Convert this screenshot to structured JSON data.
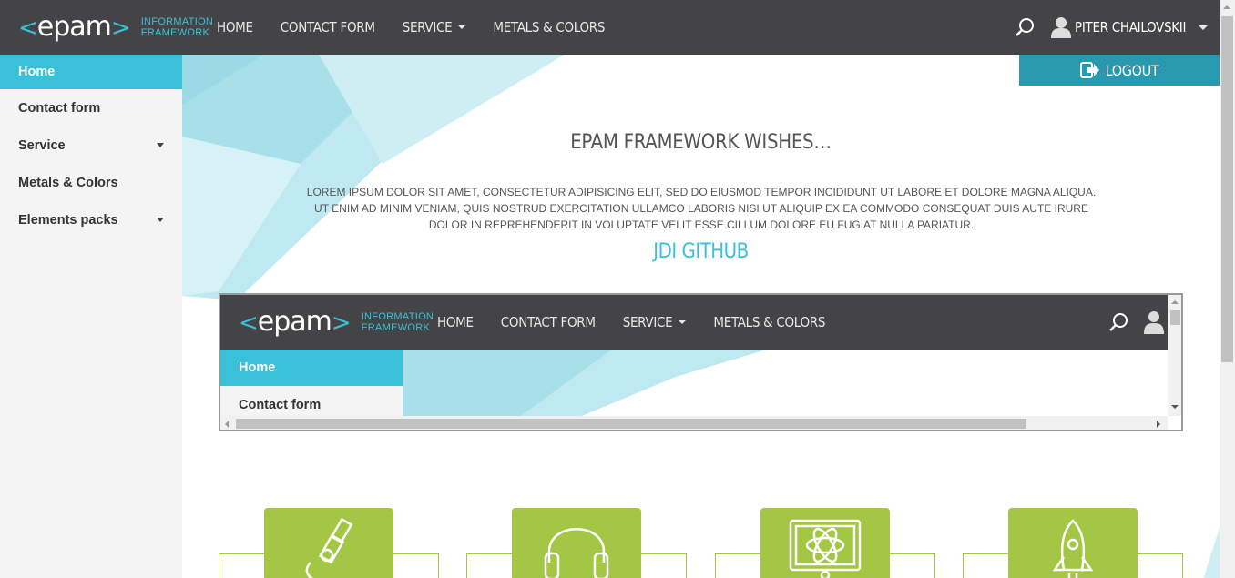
{
  "header": {
    "logo_text": "epam",
    "logo_sub_line1": "INFORMATION",
    "logo_sub_line2": "FRAMEWORK",
    "nav": [
      {
        "label": "HOME",
        "dropdown": false
      },
      {
        "label": "CONTACT FORM",
        "dropdown": false
      },
      {
        "label": "SERVICE",
        "dropdown": true
      },
      {
        "label": "METALS & COLORS",
        "dropdown": false
      }
    ],
    "user_name": "PITER CHAILOVSKII",
    "icons": {
      "search": "search-icon",
      "user": "user-icon"
    }
  },
  "sidebar": {
    "items": [
      {
        "label": "Home",
        "active": true,
        "dropdown": false
      },
      {
        "label": "Contact form",
        "active": false,
        "dropdown": false
      },
      {
        "label": "Service",
        "active": false,
        "dropdown": true
      },
      {
        "label": "Metals & Colors",
        "active": false,
        "dropdown": false
      },
      {
        "label": "Elements packs",
        "active": false,
        "dropdown": true
      }
    ]
  },
  "main": {
    "logout_label": "LOGOUT",
    "headline": "EPAM FRAMEWORK WISHES…",
    "lorem": "LOREM IPSUM DOLOR SIT AMET, CONSECTETUR ADIPISICING ELIT, SED DO EIUSMOD TEMPOR INCIDIDUNT UT LABORE ET DOLORE MAGNA ALIQUA. UT ENIM AD MINIM VENIAM, QUIS NOSTRUD EXERCITATION ULLAMCO LABORIS NISI UT ALIQUIP EX EA COMMODO CONSEQUAT DUIS AUTE IRURE DOLOR IN REPREHENDERIT IN VOLUPTATE VELIT ESSE CILLUM DOLORE EU FUGIAT NULLA PARIATUR.",
    "github_link": "JDI GITHUB"
  },
  "frame": {
    "sidebar_items": [
      "Home",
      "Contact form"
    ]
  },
  "benefits": {
    "icons": [
      "microscope-icon",
      "headphones-icon",
      "monitor-atom-icon",
      "rocket-icon"
    ]
  },
  "colors": {
    "accent": "#3ac0d8",
    "header_bg": "#444447",
    "logout_bg": "#2899ae",
    "benefit_green": "#a3c644"
  }
}
